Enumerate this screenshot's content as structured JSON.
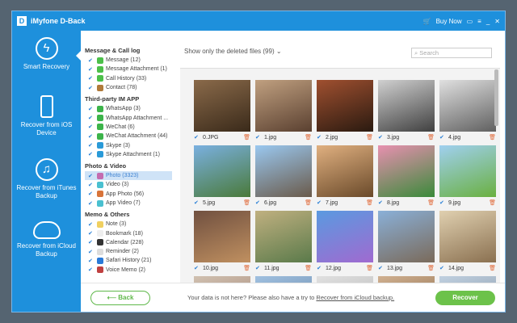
{
  "app": {
    "title": "iMyfone D-Back",
    "logo_letter": "D",
    "buy_now": "Buy Now"
  },
  "sidebar": [
    {
      "label": "Smart Recovery",
      "icon": "lightning-icon"
    },
    {
      "label": "Recover from iOS Device",
      "icon": "phone-icon"
    },
    {
      "label": "Recover from iTunes Backup",
      "icon": "music-icon"
    },
    {
      "label": "Recover from iCloud Backup",
      "icon": "cloud-icon"
    }
  ],
  "categories": [
    {
      "title": "Message & Call log",
      "items": [
        {
          "label": "Message (12)",
          "color": "#4cc04a"
        },
        {
          "label": "Message Attachment (1)",
          "color": "#4cc04a"
        },
        {
          "label": "Call History (33)",
          "color": "#4cc04a"
        },
        {
          "label": "Contact (78)",
          "color": "#b07a3a"
        }
      ]
    },
    {
      "title": "Third-party IM APP",
      "items": [
        {
          "label": "WhatsApp (3)",
          "color": "#3cb44a"
        },
        {
          "label": "WhatsApp Attachment ...",
          "color": "#3cb44a"
        },
        {
          "label": "WeChat (6)",
          "color": "#3cb44a"
        },
        {
          "label": "WeChat Attachment (44)",
          "color": "#3cb44a"
        },
        {
          "label": "Skype (3)",
          "color": "#2a9ad8"
        },
        {
          "label": "Skype Attachment (1)",
          "color": "#2a9ad8"
        }
      ]
    },
    {
      "title": "Photo & Video",
      "items": [
        {
          "label": "Photo (3323)",
          "color": "#c46cb0",
          "selected": true
        },
        {
          "label": "Video (3)",
          "color": "#4ac0d0"
        },
        {
          "label": "App Photo (56)",
          "color": "#d8743a"
        },
        {
          "label": "App Video (7)",
          "color": "#4ac0d0"
        }
      ]
    },
    {
      "title": "Memo & Others",
      "items": [
        {
          "label": "Note (3)",
          "color": "#f0d060"
        },
        {
          "label": "Bookmark (18)",
          "color": "#eeeeee"
        },
        {
          "label": "Calendar (228)",
          "color": "#333333"
        },
        {
          "label": "Reminder (2)",
          "color": "#dddddd"
        },
        {
          "label": "Safari History (21)",
          "color": "#2a7ad8"
        },
        {
          "label": "Voice Memo (2)",
          "color": "#c04040"
        }
      ]
    }
  ],
  "main": {
    "filter": "Show only the deleted files (99)",
    "search_placeholder": "Search"
  },
  "photos": [
    {
      "name": "0.JPG",
      "c": [
        "#8a6a4a",
        "#3a2a1a"
      ]
    },
    {
      "name": "1.jpg",
      "c": [
        "#c0a080",
        "#5a4030"
      ]
    },
    {
      "name": "2.jpg",
      "c": [
        "#a05030",
        "#2a1a10"
      ]
    },
    {
      "name": "3.jpg",
      "c": [
        "#d0d0d0",
        "#404040"
      ]
    },
    {
      "name": "4.jpg",
      "c": [
        "#e0e0e0",
        "#606060"
      ]
    },
    {
      "name": "5.jpg",
      "c": [
        "#7ab0e0",
        "#4a7a3a"
      ]
    },
    {
      "name": "6.jpg",
      "c": [
        "#9ac8f0",
        "#6a5a4a"
      ]
    },
    {
      "name": "7.jpg",
      "c": [
        "#e0b080",
        "#6a4a2a"
      ]
    },
    {
      "name": "8.jpg",
      "c": [
        "#e890b0",
        "#3a8a3a"
      ]
    },
    {
      "name": "9.jpg",
      "c": [
        "#a0d0f0",
        "#6ab040"
      ]
    },
    {
      "name": "10.jpg",
      "c": [
        "#705040",
        "#c09060"
      ]
    },
    {
      "name": "11.jpg",
      "c": [
        "#c0b080",
        "#5a7a4a"
      ]
    },
    {
      "name": "12.jpg",
      "c": [
        "#5a9ae0",
        "#a06ad0"
      ]
    },
    {
      "name": "13.jpg",
      "c": [
        "#8ab0d8",
        "#7a6a5a"
      ]
    },
    {
      "name": "14.jpg",
      "c": [
        "#e0d0b0",
        "#8a7050"
      ]
    },
    {
      "name": "",
      "c": [
        "#d0c0b0",
        "#a08070"
      ]
    },
    {
      "name": "",
      "c": [
        "#a0c0e0",
        "#6080a0"
      ]
    },
    {
      "name": "",
      "c": [
        "#e0e0e0",
        "#b0b0b0"
      ]
    },
    {
      "name": "",
      "c": [
        "#d0b090",
        "#806040"
      ]
    },
    {
      "name": "",
      "c": [
        "#c0d0e0",
        "#8090a0"
      ]
    }
  ],
  "bottom": {
    "back": "Back",
    "message": "Your data is not here? Please also have a try to",
    "link": "Recover from iCloud backup.",
    "recover": "Recover"
  }
}
